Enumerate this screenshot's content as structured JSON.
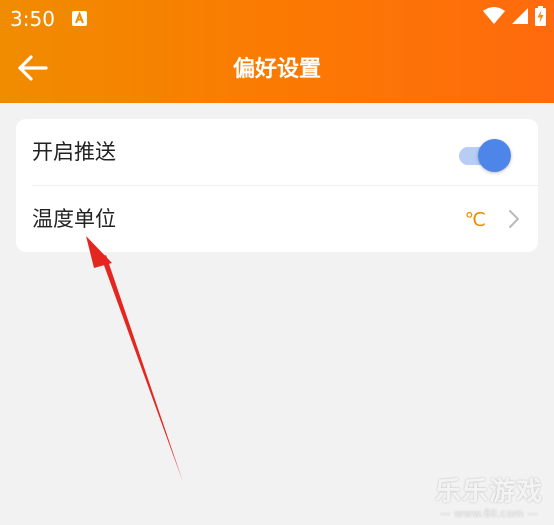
{
  "status_bar": {
    "time": "3:50",
    "notification_icon": "a-badge-icon",
    "icons": [
      "wifi-icon",
      "cellular-signal-icon",
      "battery-charging-icon"
    ]
  },
  "toolbar": {
    "back_icon": "back-arrow-icon",
    "title": "偏好设置"
  },
  "settings": {
    "push": {
      "label": "开启推送",
      "enabled": true
    },
    "unit": {
      "label": "温度单位",
      "value": "℃",
      "chevron_icon": "chevron-right-icon"
    }
  },
  "annotation": {
    "arrow_icon": "red-annotation-arrow-icon"
  },
  "watermark": {
    "title": "乐乐游戏",
    "url": "— www.6ll.com —"
  },
  "colors": {
    "header_start": "#f08c00",
    "header_end": "#ff6a0e",
    "accent": "#f08c00",
    "toggle_on": "#4d86e8",
    "toggle_track_on": "#b7cdf4",
    "background": "#f2f2f2",
    "annotation_red": "#e52620"
  }
}
